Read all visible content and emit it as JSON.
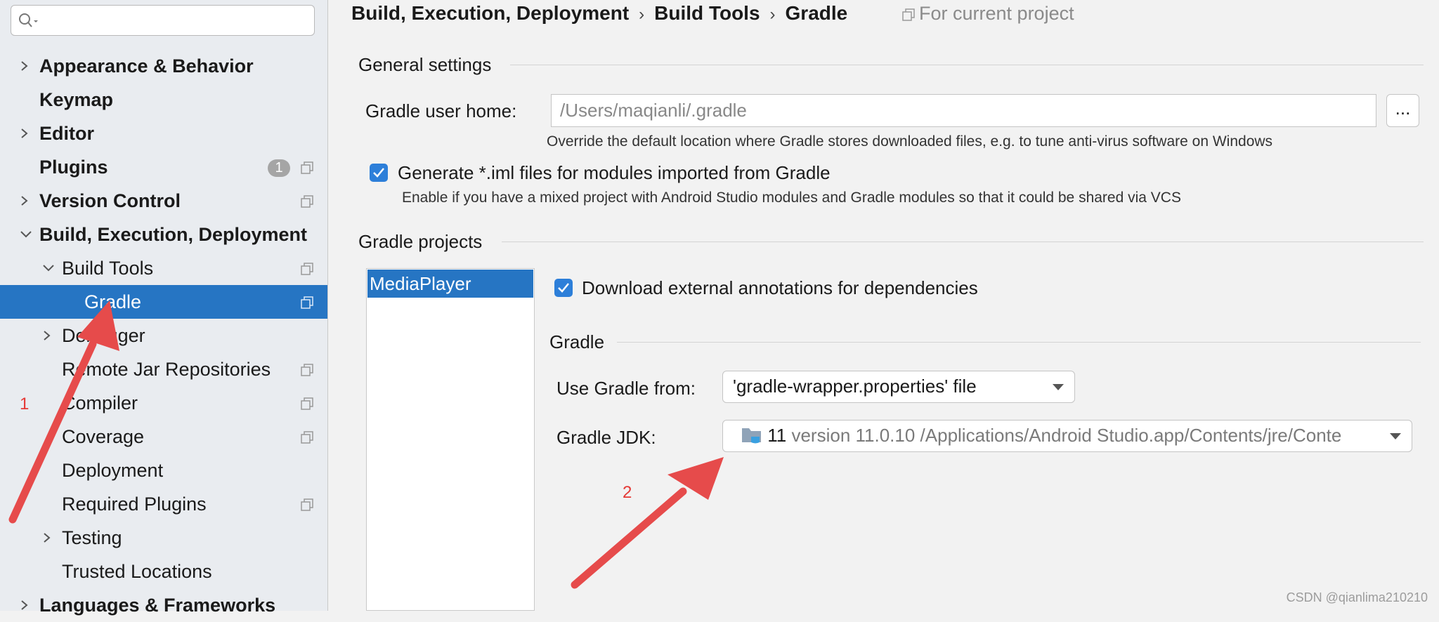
{
  "sidebar": {
    "search_placeholder": "",
    "items": [
      {
        "label": "Appearance & Behavior"
      },
      {
        "label": "Keymap"
      },
      {
        "label": "Editor"
      },
      {
        "label": "Plugins",
        "badge": "1"
      },
      {
        "label": "Version Control"
      },
      {
        "label": "Build, Execution, Deployment"
      },
      {
        "label": "Build Tools"
      },
      {
        "label": "Gradle"
      },
      {
        "label": "Debugger"
      },
      {
        "label": "Remote Jar Repositories"
      },
      {
        "label": "Compiler"
      },
      {
        "label": "Coverage"
      },
      {
        "label": "Deployment"
      },
      {
        "label": "Required Plugins"
      },
      {
        "label": "Testing"
      },
      {
        "label": "Trusted Locations"
      },
      {
        "label": "Languages & Frameworks"
      }
    ]
  },
  "breadcrumb": {
    "items": [
      "Build, Execution, Deployment",
      "Build Tools",
      "Gradle"
    ],
    "scope": "For current project"
  },
  "general": {
    "title": "General settings",
    "user_home_label": "Gradle user home:",
    "user_home_value": "/Users/maqianli/.gradle",
    "browse_label": "...",
    "user_home_hint": "Override the default location where Gradle stores downloaded files, e.g. to tune anti-virus software on Windows",
    "iml_label": "Generate *.iml files for modules imported from Gradle",
    "iml_hint": "Enable if you have a mixed project with Android Studio modules and Gradle modules so that it could be shared via VCS",
    "iml_checked": true
  },
  "projects": {
    "title": "Gradle projects",
    "list": [
      "MediaPlayer"
    ],
    "download_annotations_label": "Download external annotations for dependencies",
    "download_annotations_checked": true,
    "gradle_title": "Gradle",
    "use_gradle_from_label": "Use Gradle from:",
    "use_gradle_from_value": "'gradle-wrapper.properties' file",
    "jdk_label": "Gradle JDK:",
    "jdk_name": "11",
    "jdk_path": "version 11.0.10 /Applications/Android Studio.app/Contents/jre/Conte"
  },
  "annotations": [
    "1",
    "2"
  ],
  "watermark": "CSDN @qianlima210210",
  "colors": {
    "selection": "#2675c3",
    "checkbox": "#2d7fd9",
    "arrow": "#e64b4b"
  }
}
